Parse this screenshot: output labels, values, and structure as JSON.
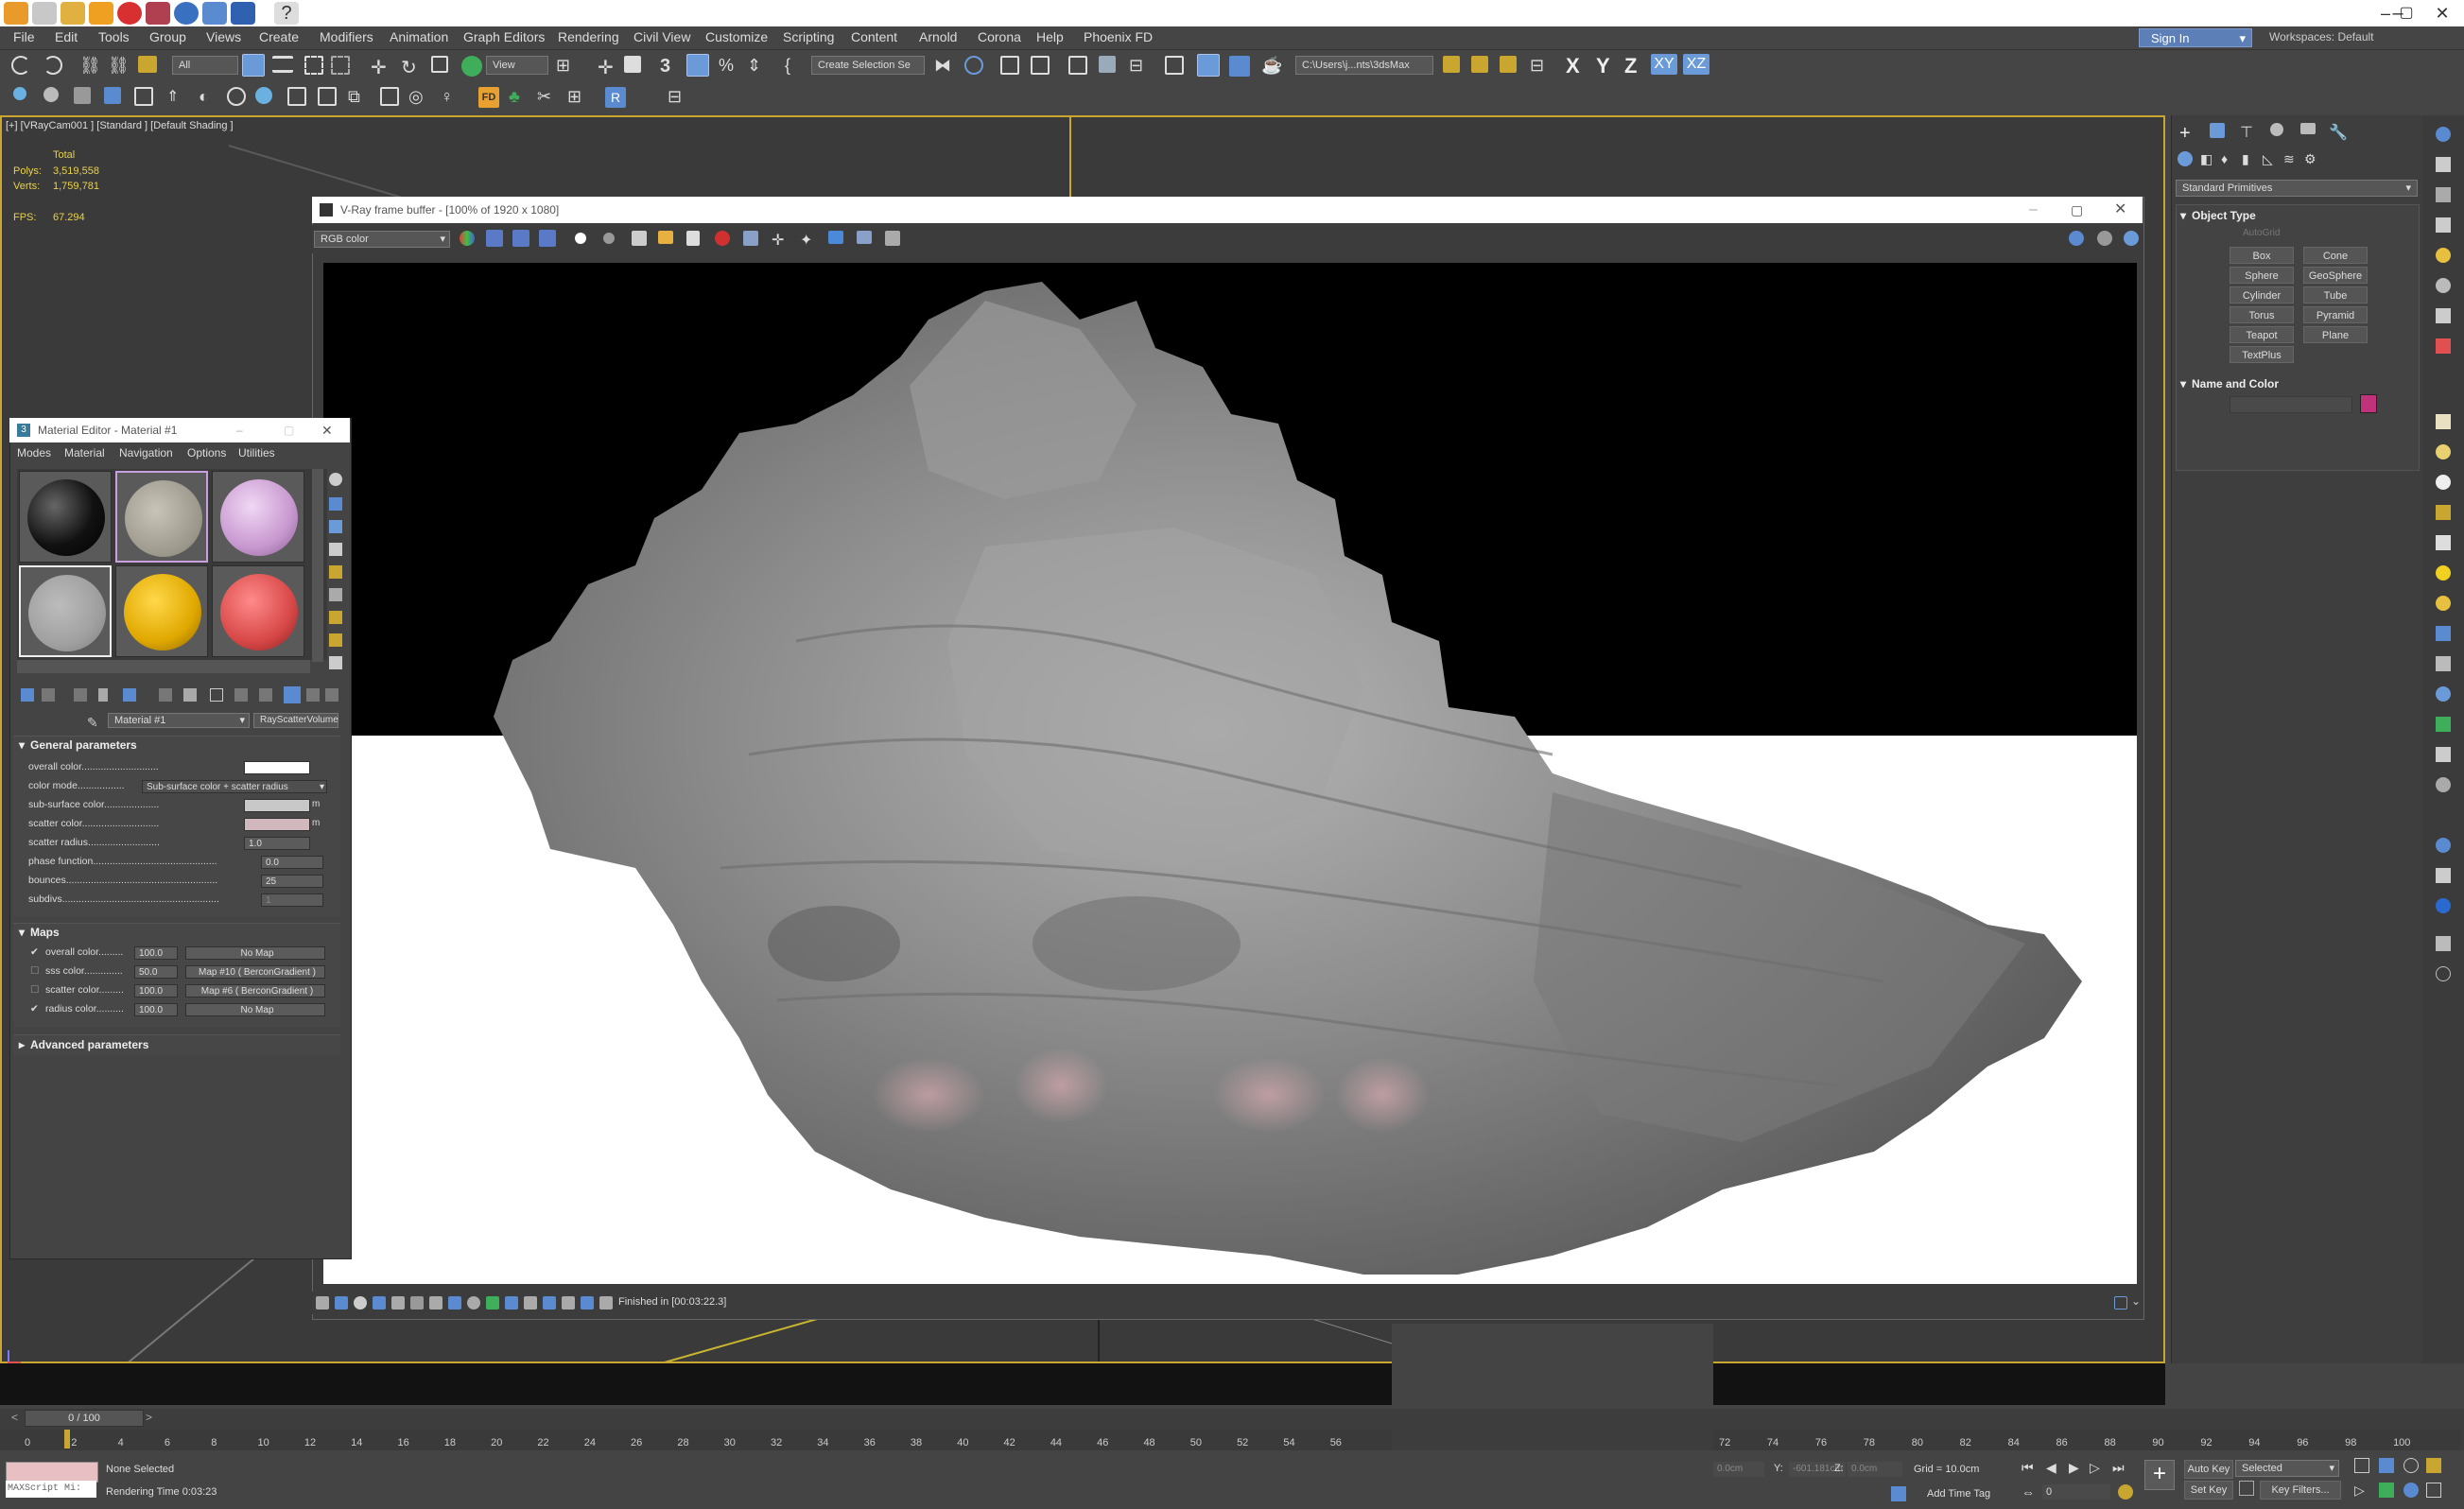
{
  "menu": [
    "File",
    "Edit",
    "Tools",
    "Group",
    "Views",
    "Create",
    "Modifiers",
    "Animation",
    "Graph Editors",
    "Rendering",
    "Civil View",
    "Customize",
    "Scripting",
    "Content",
    "Arnold",
    "Corona",
    "Help",
    "Phoenix FD"
  ],
  "account": {
    "sign_in": "Sign In",
    "workspaces": "Workspaces: Default"
  },
  "toolbar": {
    "filter": "All",
    "refcoord": "View",
    "selection_set": "Create Selection Se",
    "project_path": "C:\\Users\\j...nts\\3dsMax",
    "axes": [
      "X",
      "Y",
      "Z",
      "XY",
      "XZ"
    ]
  },
  "viewport": {
    "label": "[+] [VRayCam001 ] [Standard ] [Default Shading ]",
    "stats": {
      "total": "Total",
      "polys_label": "Polys:",
      "polys": "3,519,558",
      "verts_label": "Verts:",
      "verts": "1,759,781",
      "fps_label": "FPS:",
      "fps": "67.294"
    }
  },
  "command_panel": {
    "category": "Standard Primitives",
    "object_type_title": "Object Type",
    "autogrid": "AutoGrid",
    "buttons": [
      "Box",
      "Cone",
      "Sphere",
      "GeoSphere",
      "Cylinder",
      "Tube",
      "Torus",
      "Pyramid",
      "Teapot",
      "Plane",
      "TextPlus"
    ],
    "name_color_title": "Name and Color",
    "object_color": "#c0337a"
  },
  "vfb": {
    "title": "V-Ray frame buffer - [100% of 1920 x 1080]",
    "channel": "RGB color",
    "status": "Finished in [00:03:22.3]"
  },
  "material_editor": {
    "title": "Material Editor - Material #1",
    "menu": [
      "Modes",
      "Material",
      "Navigation",
      "Options",
      "Utilities"
    ],
    "material_name": "Material #1",
    "material_type": "RayScatterVolume",
    "general_title": "General parameters",
    "params": [
      {
        "label": "overall color",
        "value": ""
      },
      {
        "label": "color mode",
        "value": "Sub-surface color + scatter radius"
      },
      {
        "label": "sub-surface color",
        "value": ""
      },
      {
        "label": "scatter color",
        "value": ""
      },
      {
        "label": "scatter radius",
        "value": "1.0"
      },
      {
        "label": "phase function",
        "value": "0.0"
      },
      {
        "label": "bounces",
        "value": "25"
      },
      {
        "label": "subdivs",
        "value": "1"
      }
    ],
    "maps_title": "Maps",
    "maps": [
      {
        "label": "overall color",
        "amount": "100.0",
        "map": "No Map",
        "checked": true
      },
      {
        "label": "sss color",
        "amount": "50.0",
        "map": "Map #10 ( BerconGradient )",
        "checked": false
      },
      {
        "label": "scatter color",
        "amount": "100.0",
        "map": "Map #6 ( BerconGradient )",
        "checked": false
      },
      {
        "label": "radius color",
        "amount": "100.0",
        "map": "No Map",
        "checked": true
      }
    ],
    "advanced_title": "Advanced parameters"
  },
  "timeline": {
    "frame": "0 / 100",
    "ticks": [
      "0",
      "2",
      "4",
      "6",
      "8",
      "10",
      "12",
      "14",
      "16",
      "18",
      "20",
      "22",
      "24",
      "26",
      "28",
      "30",
      "32",
      "34",
      "36",
      "38",
      "40",
      "42",
      "44",
      "46",
      "48",
      "50",
      "52",
      "54",
      "56"
    ],
    "ticks_right": [
      "72",
      "74",
      "76",
      "78",
      "80",
      "82",
      "84",
      "86",
      "88",
      "90",
      "92",
      "94",
      "96",
      "98",
      "100"
    ]
  },
  "status": {
    "maxscript": "MAXScript Mi:",
    "selection": "None Selected",
    "render_time": "Rendering Time  0:03:23",
    "x": "0.0cm",
    "y_label": "Y:",
    "y": "-601.181cm",
    "z_label": "Z:",
    "z": "0.0cm",
    "grid": "Grid = 10.0cm",
    "add_time_tag": "Add Time Tag",
    "auto_key": "Auto Key",
    "set_key": "Set Key",
    "key_mode": "Selected",
    "key_filters": "Key Filters...",
    "frame_field": "0"
  }
}
